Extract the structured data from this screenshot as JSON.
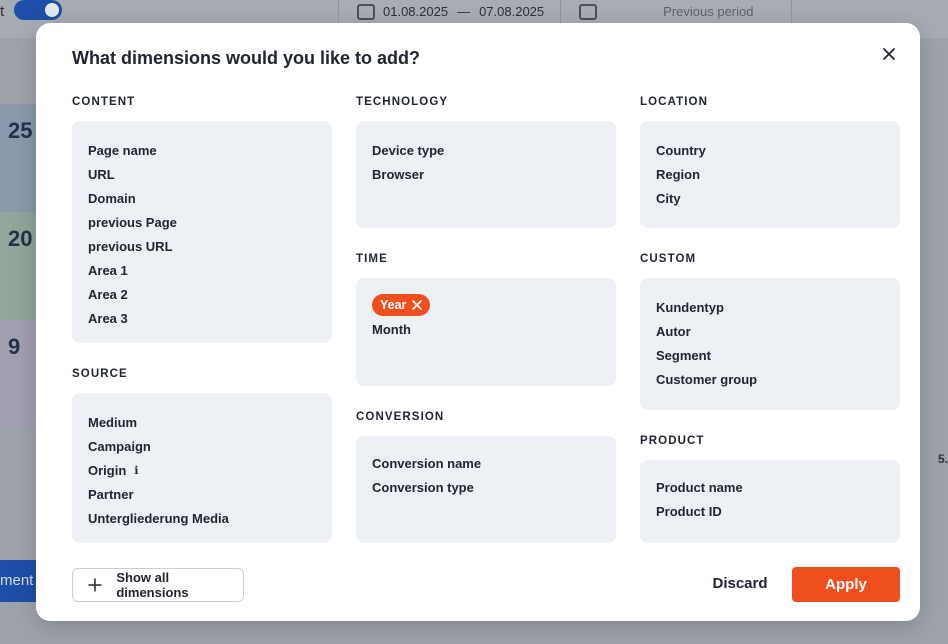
{
  "background": {
    "toggle_label": "t",
    "date_from": "01.08.2025",
    "date_dash": "—",
    "date_to": "07.08.2025",
    "compare_label": "Previous period",
    "card_values": [
      "25",
      "20",
      "9"
    ],
    "bottom_button": "ment",
    "right_axis_label": "5."
  },
  "modal": {
    "title": "What dimensions would you like to add?",
    "close_icon": "close-icon",
    "accent_color": "#ef4f1e",
    "sections": {
      "content": {
        "title": "CONTENT",
        "items": [
          "Page name",
          "URL",
          "Domain",
          "previous Page",
          "previous URL",
          "Area 1",
          "Area 2",
          "Area 3"
        ]
      },
      "source": {
        "title": "SOURCE",
        "items": [
          "Medium",
          "Campaign",
          "Origin",
          "Partner",
          "Untergliederung Media"
        ]
      },
      "technology": {
        "title": "TECHNOLOGY",
        "items": [
          "Device type",
          "Browser"
        ]
      },
      "time": {
        "title": "TIME",
        "selected": "Year",
        "items": [
          "Month"
        ]
      },
      "conversion": {
        "title": "CONVERSION",
        "items": [
          "Conversion name",
          "Conversion type"
        ]
      },
      "location": {
        "title": "LOCATION",
        "items": [
          "Country",
          "Region",
          "City"
        ]
      },
      "custom": {
        "title": "CUSTOM",
        "items": [
          "Kundentyp",
          "Autor",
          "Segment",
          "Customer group"
        ]
      },
      "product": {
        "title": "PRODUCT",
        "items": [
          "Product name",
          "Product ID"
        ]
      }
    },
    "footer": {
      "show_all_label": "Show all dimensions",
      "discard_label": "Discard",
      "apply_label": "Apply"
    }
  }
}
